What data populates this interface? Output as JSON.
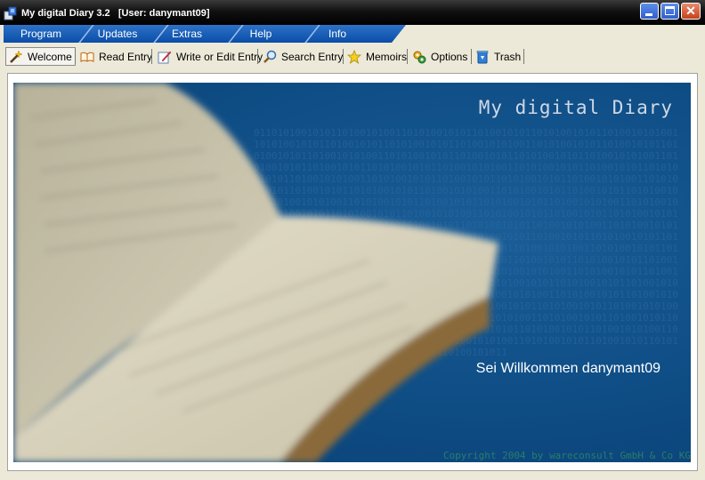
{
  "window": {
    "title": "My digital Diary 3.2   [User: danymant09]",
    "minimize_label": "_",
    "maximize_label": "□",
    "close_label": "✕"
  },
  "menu": [
    {
      "label": "Program"
    },
    {
      "label": "Updates"
    },
    {
      "label": "Extras"
    },
    {
      "label": "Help"
    },
    {
      "label": "Info"
    }
  ],
  "toolbar": [
    {
      "label": "Welcome",
      "icon": "magic-wand-icon"
    },
    {
      "label": "Read Entry",
      "icon": "open-book-icon"
    },
    {
      "label": "Write or Edit Entry",
      "icon": "pencil-icon"
    },
    {
      "label": "Search Entry",
      "icon": "magnifier-icon"
    },
    {
      "label": "Memoirs",
      "icon": "star-icon"
    },
    {
      "label": "Options",
      "icon": "gear-icon"
    },
    {
      "label": "Trash",
      "icon": "recycle-bin-icon"
    }
  ],
  "banner": {
    "title": "My digital Diary",
    "welcome": "Sei Willkommen danymant09",
    "copyright": "Copyright 2004 by wareconsult GmbH & Co KG"
  },
  "colors": {
    "menu_blue": "#0A4DA8",
    "banner_blue": "#0E4C84",
    "titlebar": "#000000"
  }
}
